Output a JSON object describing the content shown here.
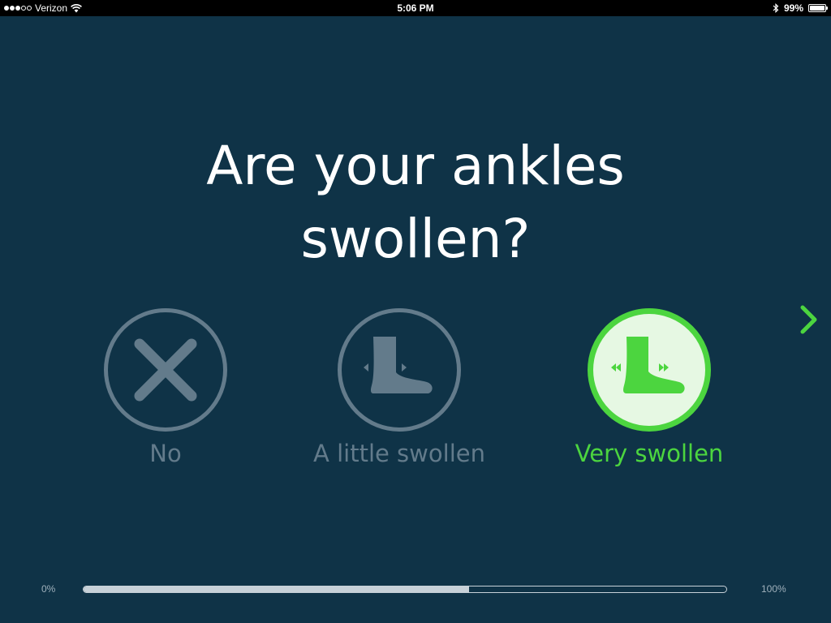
{
  "status_bar": {
    "carrier": "Verizon",
    "signal_bars": 3,
    "signal_total": 5,
    "time": "5:06 PM",
    "battery_percent_label": "99%",
    "battery_level": 0.99
  },
  "question": {
    "text": "Are your ankles swollen?"
  },
  "options": [
    {
      "label": "No",
      "icon": "x-icon",
      "selected": false
    },
    {
      "label": "A little swollen",
      "icon": "foot-slightly-swollen-icon",
      "selected": false
    },
    {
      "label": "Very swollen",
      "icon": "foot-very-swollen-icon",
      "selected": true
    }
  ],
  "navigation": {
    "next_icon": "chevron-right-icon"
  },
  "progress": {
    "min_label": "0%",
    "max_label": "100%",
    "value": 0.6
  },
  "colors": {
    "background": "#0f3347",
    "inactive": "#637b8b",
    "accent": "#4cd53f",
    "selected_fill": "#e6f8e3"
  }
}
